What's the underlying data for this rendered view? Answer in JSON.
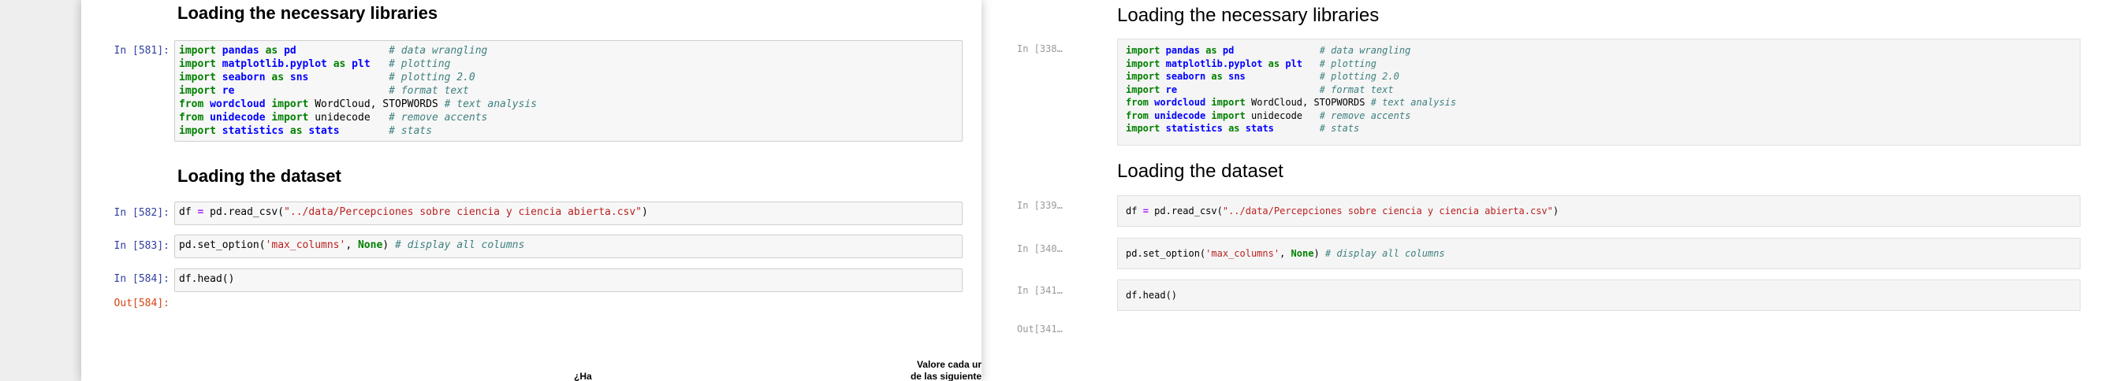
{
  "left": {
    "heading_libraries": "Loading the necessary libraries",
    "heading_dataset": "Loading the dataset",
    "prompts": {
      "in1": "In [581]:",
      "in2": "In [582]:",
      "in3": "In [583]:",
      "in4": "In [584]:",
      "out4": "Out[584]:"
    },
    "table_header_fragments": {
      "col_a": "¿Ha",
      "col_b_line1": "Valore cada ur",
      "col_b_line2": "de las siguiente"
    }
  },
  "right": {
    "heading_libraries": "Loading the necessary libraries",
    "heading_dataset": "Loading the dataset",
    "prompts": {
      "in1": "In [338…",
      "in2": "In [339…",
      "in3": "In [340…",
      "in4": "In [341…",
      "out4": "Out[341…"
    }
  },
  "code": {
    "imports": [
      {
        "parts": [
          {
            "t": "import",
            "c": "kw"
          },
          {
            "t": " "
          },
          {
            "t": "pandas",
            "c": "mod"
          },
          {
            "t": " "
          },
          {
            "t": "as",
            "c": "kw"
          },
          {
            "t": " "
          },
          {
            "t": "pd",
            "c": "mod"
          }
        ],
        "comment": "# data wrangling"
      },
      {
        "parts": [
          {
            "t": "import",
            "c": "kw"
          },
          {
            "t": " "
          },
          {
            "t": "matplotlib.pyplot",
            "c": "mod"
          },
          {
            "t": " "
          },
          {
            "t": "as",
            "c": "kw"
          },
          {
            "t": " "
          },
          {
            "t": "plt",
            "c": "mod"
          }
        ],
        "comment": "# plotting"
      },
      {
        "parts": [
          {
            "t": "import",
            "c": "kw"
          },
          {
            "t": " "
          },
          {
            "t": "seaborn",
            "c": "mod"
          },
          {
            "t": " "
          },
          {
            "t": "as",
            "c": "kw"
          },
          {
            "t": " "
          },
          {
            "t": "sns",
            "c": "mod"
          }
        ],
        "comment": "# plotting 2.0"
      },
      {
        "parts": [
          {
            "t": "import",
            "c": "kw"
          },
          {
            "t": " "
          },
          {
            "t": "re",
            "c": "mod"
          }
        ],
        "comment": "# format text"
      },
      {
        "parts": [
          {
            "t": "from",
            "c": "kw"
          },
          {
            "t": " "
          },
          {
            "t": "wordcloud",
            "c": "mod"
          },
          {
            "t": " "
          },
          {
            "t": "import",
            "c": "kw"
          },
          {
            "t": " WordCloud, STOPWORDS"
          }
        ],
        "comment": "# text analysis"
      },
      {
        "parts": [
          {
            "t": "from",
            "c": "kw"
          },
          {
            "t": " "
          },
          {
            "t": "unidecode",
            "c": "mod"
          },
          {
            "t": " "
          },
          {
            "t": "import",
            "c": "kw"
          },
          {
            "t": " unidecode"
          }
        ],
        "comment": "# remove accents"
      },
      {
        "parts": [
          {
            "t": "import",
            "c": "kw"
          },
          {
            "t": " "
          },
          {
            "t": "statistics",
            "c": "mod"
          },
          {
            "t": " "
          },
          {
            "t": "as",
            "c": "kw"
          },
          {
            "t": " "
          },
          {
            "t": "stats",
            "c": "mod"
          }
        ],
        "comment": "# stats"
      }
    ],
    "read_csv": [
      {
        "t": "df "
      },
      {
        "t": "=",
        "c": "op"
      },
      {
        "t": " pd.read_csv("
      },
      {
        "t": "\"../data/Percepciones sobre ciencia y ciencia abierta.csv\"",
        "c": "st"
      },
      {
        "t": ")"
      }
    ],
    "set_option": [
      {
        "t": "pd.set_option("
      },
      {
        "t": "'max_columns'",
        "c": "st"
      },
      {
        "t": ", "
      },
      {
        "t": "None",
        "c": "nn"
      },
      {
        "t": ") "
      },
      {
        "t": "# display all columns",
        "c": "cm"
      }
    ],
    "head": [
      {
        "t": "df.head()"
      }
    ]
  },
  "colors": {
    "in_prompt": "#303f9f",
    "out_prompt": "#d84315",
    "keyword": "#008000",
    "module": "#0000ff",
    "comment": "#408080",
    "string": "#ba2121"
  }
}
